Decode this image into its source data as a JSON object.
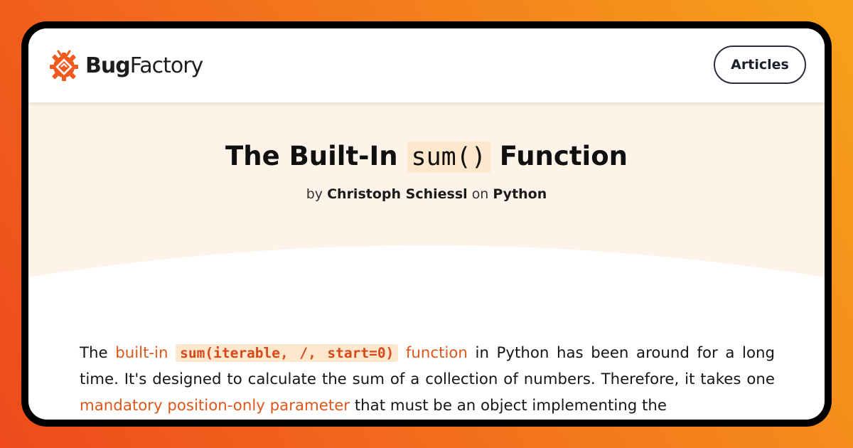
{
  "brand": {
    "name_bold": "Bug",
    "name_rest": "Factory",
    "logo_icon": "bug-gear-icon",
    "brand_color": "#f15a1f"
  },
  "nav": {
    "articles_label": "Articles"
  },
  "article": {
    "title_before": "The Built-In ",
    "title_code": "sum()",
    "title_after": " Function",
    "byline_by": "by",
    "author": "Christoph Schiessl",
    "byline_on": "on",
    "category": "Python",
    "paragraph": {
      "t1": "The ",
      "link1": "built-in",
      "code1": "sum(iterable, /, start=0)",
      "link2": "function",
      "t2": " in Python has been around for a long time. It's designed to calculate the sum of a collection of numbers. Therefore, it takes one ",
      "link3": "mandatory position-only parameter",
      "t3": " that must be an object implementing the"
    }
  },
  "colors": {
    "accent": "#e0561a",
    "hero_bg": "#fdf3e8",
    "code_bg": "#fde7cd"
  }
}
